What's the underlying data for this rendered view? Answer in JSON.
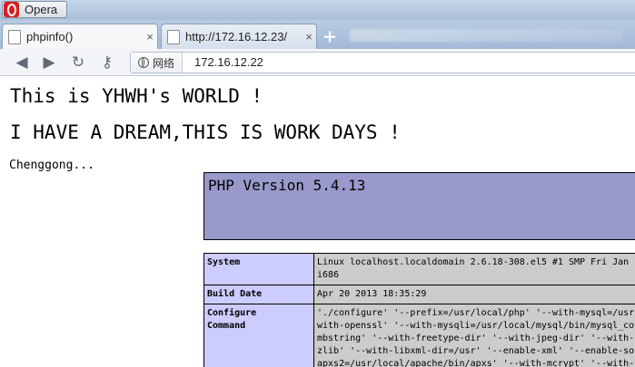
{
  "window": {
    "app_button": "Opera"
  },
  "tabs": [
    {
      "title": "phpinfo()",
      "close": "×"
    },
    {
      "title": "http://172.16.12.23/",
      "close": "×"
    }
  ],
  "new_tab_symbol": "+",
  "toolbar": {
    "back": "◀",
    "forward": "▶",
    "reload": "↻",
    "key": "⚷",
    "site_label": "网络",
    "url": "172.16.12.22"
  },
  "page": {
    "heading1": "This is YHWH's WORLD !",
    "heading2": "I HAVE A DREAM,THIS IS WORK DAYS !",
    "status_text": "Chenggong...",
    "php_version": "PHP Version 5.4.13",
    "table": [
      {
        "key": "System",
        "value": "Linux localhost.localdomain 2.6.18-308.el5 #1 SMP Fri Jan 2\ni686"
      },
      {
        "key": "Build Date",
        "value": "Apr 20 2013 18:35:29"
      },
      {
        "key": "Configure\nCommand",
        "value": "'./configure' '--prefix=/usr/local/php' '--with-mysql=/usr/\nwith-openssl' '--with-mysqli=/usr/local/mysql/bin/mysql_con\nmbstring' '--with-freetype-dir' '--with-jpeg-dir' '--with-p\nzlib' '--with-libxml-dir=/usr' '--enable-xml' '--enable-soc\napxs2=/usr/local/apache/bin/apxs' '--with-mcrypt' '--with-"
      }
    ]
  },
  "colors": {
    "php_header_bg": "#9999cc",
    "table_key_bg": "#ccccff",
    "table_value_bg": "#cccccc"
  }
}
